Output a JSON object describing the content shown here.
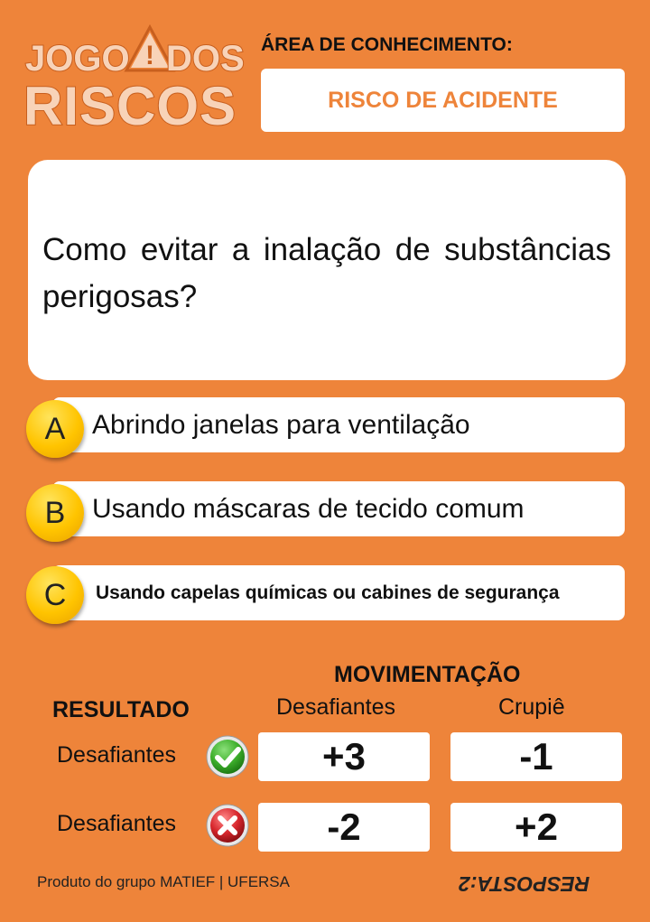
{
  "logo": {
    "line1_left": "JOGO",
    "line1_right": "DOS",
    "line2": "RISCOS",
    "warning_symbol": "!"
  },
  "area": {
    "title": "ÁREA DE CONHECIMENTO:",
    "value": "RISCO DE ACIDENTE"
  },
  "question": "Como evitar a inalação de substâncias perigosas?",
  "answers": [
    {
      "letter": "A",
      "text": "Abrindo janelas para ventilação"
    },
    {
      "letter": "B",
      "text": "Usando máscaras de tecido comum"
    },
    {
      "letter": "C",
      "text": "Usando capelas químicas ou cabines de segurança"
    }
  ],
  "movement": {
    "title": "MOVIMENTAÇÃO",
    "col_challengers": "Desafiantes",
    "col_dealer": "Crupiê",
    "result_label": "RESULTADO",
    "rows": [
      {
        "label": "Desafiantes",
        "icon": "check-icon",
        "challengers": "+3",
        "dealer": "-1"
      },
      {
        "label": "Desafiantes",
        "icon": "cross-icon",
        "challengers": "-2",
        "dealer": "+2"
      }
    ]
  },
  "footer": "Produto do grupo MATIEF | UFERSA",
  "answer_key": "RESPOSTA:2",
  "colors": {
    "background": "#EE843A",
    "accent_text": "#EE843A",
    "letter_circle": "#FFC400",
    "check": "#3DAE2B",
    "cross": "#D7262C"
  }
}
